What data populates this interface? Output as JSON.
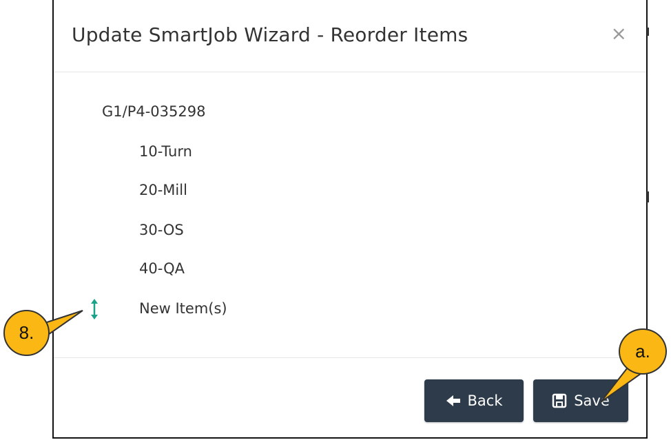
{
  "dialog": {
    "title": "Update SmartJob Wizard - Reorder Items",
    "close_label": "×"
  },
  "tree": {
    "root": "G1/P4-035298",
    "children": [
      "10-Turn",
      "20-Mill",
      "30-OS",
      "40-QA",
      "New Item(s)"
    ]
  },
  "footer": {
    "back_label": "Back",
    "save_label": "Save"
  },
  "callouts": {
    "left": "8.",
    "right": "a."
  },
  "colors": {
    "button_bg": "#2d3b4a",
    "drag_icon": "#1aa38a",
    "callout_fill": "#fbb713"
  },
  "icons": {
    "drag": "vertical-resize-arrow-icon",
    "back": "arrow-left-icon",
    "save": "floppy-disk-icon",
    "close": "close-icon"
  }
}
